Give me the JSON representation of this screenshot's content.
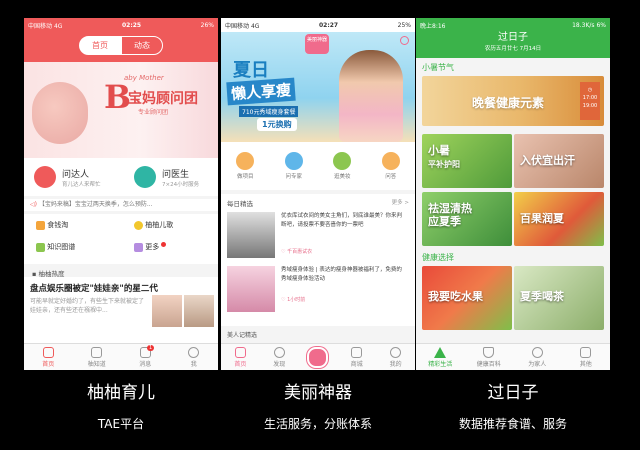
{
  "app1": {
    "status": {
      "carrier": "中国移动",
      "net": "4G",
      "time": "02:25",
      "battery": "26%"
    },
    "tabs": [
      "首页",
      "动态"
    ],
    "banner": {
      "script": "aby Mother",
      "big": "B",
      "title": "宝妈顾问团",
      "sub": "专业顾问团"
    },
    "services": [
      {
        "title": "问达人",
        "desc": "育儿达人来帮忙"
      },
      {
        "title": "问医生",
        "desc": "7×24小时服务"
      }
    ],
    "notice": "【宝妈来稿】宝宝过两天换季，怎么预防...",
    "grid": [
      {
        "label": "食钱淘"
      },
      {
        "label": "柚柚儿歌"
      },
      {
        "label": "知识图谱"
      },
      {
        "label": "更多"
      }
    ],
    "section_title": "柚柚热度",
    "headline": "盘点娱乐圈被定\"娃娃亲\"的星二代",
    "article_text": "可能早就定好婚约了，有些生下来就被定了娃娃亲，还有些还在襁褓中...",
    "tabbar": [
      "首页",
      "柚知道",
      "消息",
      "我"
    ],
    "badge": "1",
    "colors": {
      "primary": "#ef5a5a"
    }
  },
  "app2": {
    "status": {
      "carrier": "中国移动",
      "net": "4G",
      "time": "02:27",
      "battery": "25%"
    },
    "logo": "美丽神器",
    "banner": {
      "line1": "夏日",
      "line2": "懒人享瘦",
      "line3": "710元秀域瘦身套餐",
      "line4": "1元换购"
    },
    "icons": [
      {
        "label": "做项目"
      },
      {
        "label": "问专家"
      },
      {
        "label": "逛美妆"
      },
      {
        "label": "问答"
      }
    ],
    "feed_title": "每日精选",
    "feed_more": "更多 >",
    "items": [
      {
        "text": "优衣库试衣间的美女主角们，到底谁最美？你来判断吧，请投票不要吝啬你的一票吧",
        "meta": "♡ 千百惠试衣"
      },
      {
        "text": "秀域瘦身体验 | 表达的瘦身神器被福利了，免费的秀域瘦身体验活动",
        "meta": "♡ 1小时前"
      }
    ],
    "next_title": "美人记精选",
    "tabbar": [
      "首页",
      "发现",
      "",
      "商城",
      "我的"
    ],
    "colors": {
      "primary": "#f06b8c"
    }
  },
  "app3": {
    "status": {
      "time": "晚上8:16",
      "speed": "18.3K/s",
      "battery": "6%"
    },
    "title": "过日子",
    "date": "农历五月廿七  7月14日",
    "section1": "小暑节气",
    "hero": {
      "text": "晚餐健康元素",
      "time": "17:00",
      "time2": "19:00"
    },
    "tiles1": [
      {
        "label": "小暑",
        "label2": "平补护阳"
      },
      {
        "label": "入伏宜出汗"
      },
      {
        "label": "祛湿清热",
        "label2": "应夏季"
      },
      {
        "label": "百果润夏"
      }
    ],
    "section2": "健康选择",
    "tiles2": [
      {
        "label": "我要吃水果"
      },
      {
        "label": "夏季喝茶"
      }
    ],
    "tabbar": [
      "精彩生活",
      "健康百科",
      "为家人",
      "其他"
    ],
    "colors": {
      "primary": "#3bb34a"
    }
  },
  "captions": [
    {
      "title": "柚柚育儿",
      "sub": "TAE平台"
    },
    {
      "title": "美丽神器",
      "sub": "生活服务，分账体系"
    },
    {
      "title": "过日子",
      "sub": "数据推荐食谱、服务"
    }
  ]
}
